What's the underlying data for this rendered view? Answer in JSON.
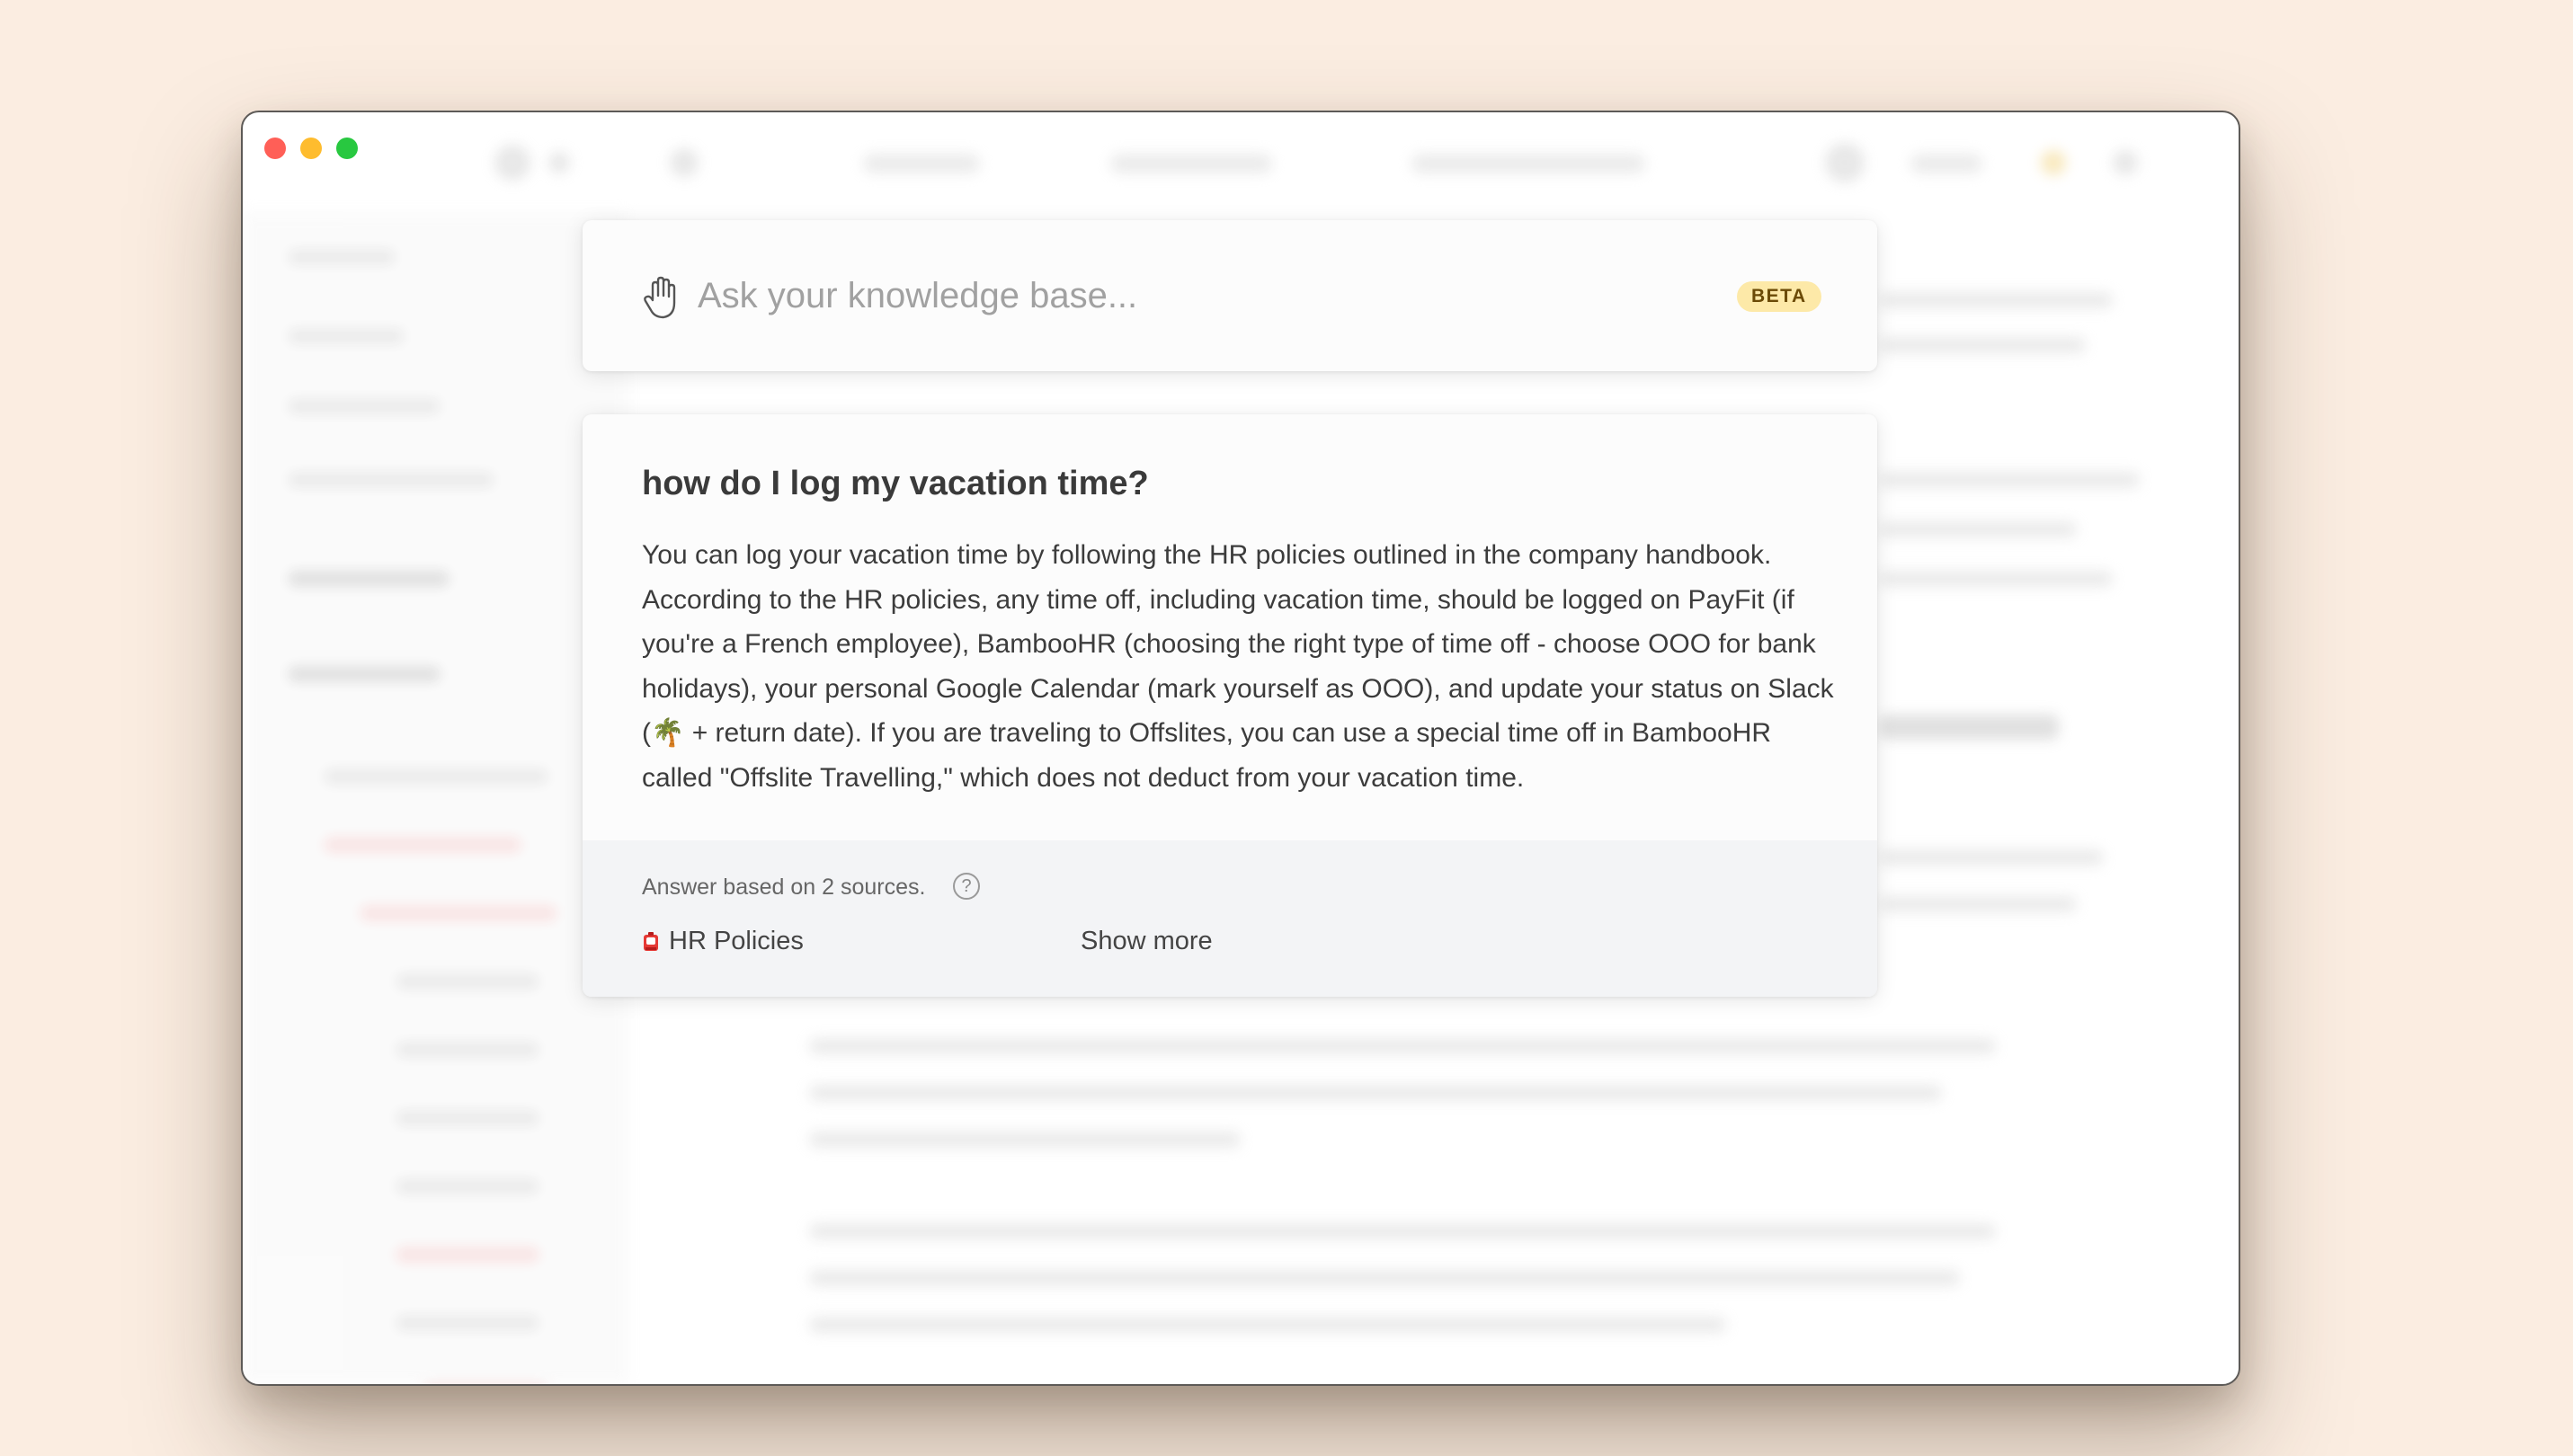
{
  "search": {
    "placeholder": "Ask your knowledge base...",
    "badge": "BETA"
  },
  "answer": {
    "question": "how do I log my vacation time?",
    "text_before_icon": "You can log your vacation time by following the HR policies outlined in the company handbook. According to the HR policies, any time off, including vacation time, should be logged on PayFit (if you're a French employee), BambooHR (choosing the right type of time off - choose OOO for bank holidays), your personal Google Calendar (mark yourself as OOO), and update your status on Slack (",
    "inline_icon": "🌴",
    "text_after_icon": " + return date). If you are traveling to Offslites, you can use a special time off in BambooHR called \"Offslite Travelling,\" which does not deduct from your vacation time."
  },
  "sources": {
    "label": "Answer based on 2 sources.",
    "help_icon": "?",
    "items": [
      {
        "icon": "alarm-icon",
        "label": "HR Policies"
      }
    ],
    "show_more": "Show more"
  },
  "colors": {
    "background": "#fbede1",
    "badge_bg": "#fde9a8",
    "badge_text": "#6b4a06",
    "traffic_red": "#ff5f57",
    "traffic_yellow": "#febc2e",
    "traffic_green": "#28c840"
  }
}
